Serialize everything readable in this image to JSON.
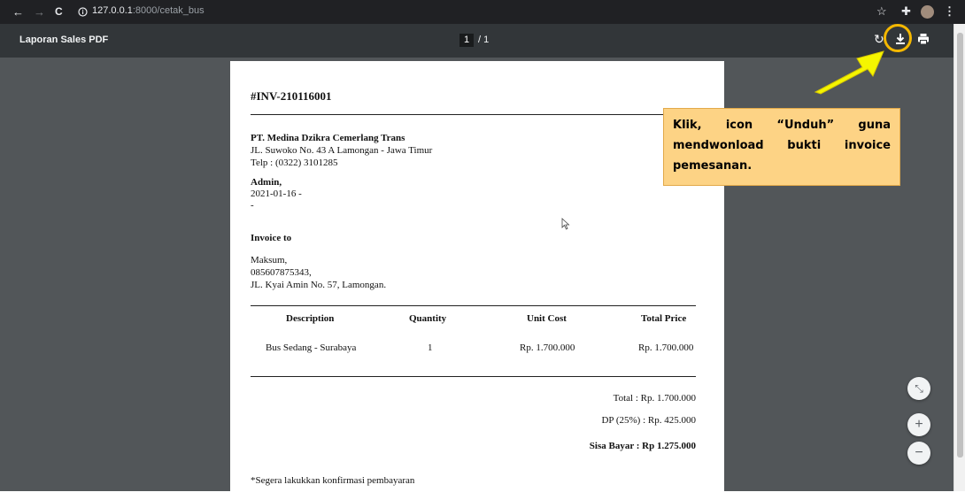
{
  "browser": {
    "nav": {
      "back": "←",
      "forward": "→",
      "reload": "C"
    },
    "info_icon": "info-circle-icon",
    "url_host": "127.0.0.1",
    "url_path": ":8000/cetak_bus",
    "right_icons": {
      "star": "☆",
      "extensions": "✚",
      "menu": "⋮"
    }
  },
  "pdf_toolbar": {
    "title": "Laporan Sales PDF",
    "current_page": "1",
    "page_separator": "/ 1",
    "rotate": "↻"
  },
  "invoice": {
    "number": "#INV-210116001",
    "company_name": "PT. Medina Dzikra Cemerlang Trans",
    "company_address": "JL. Suwoko No. 43 A Lamongan - Jawa Timur",
    "company_phone": "Telp : (0322) 3101285",
    "admin_label": "Admin,",
    "admin_date": "2021-01-16 -",
    "admin_extra": "-",
    "invoice_to_label": "Invoice to",
    "customer_name": "Maksum,",
    "customer_phone": "085607875343,",
    "customer_address": "JL. Kyai Amin No. 57, Lamongan.",
    "table": {
      "headers": [
        "Description",
        "Quantity",
        "Unit Cost",
        "Total Price"
      ],
      "rows": [
        [
          "Bus Sedang - Surabaya",
          "1",
          "Rp. 1.700.000",
          "Rp. 1.700.000"
        ]
      ]
    },
    "total": "Total : Rp. 1.700.000",
    "dp": "DP (25%) : Rp. 425.000",
    "sisa_bayar": "Sisa Bayar : Rp 1.275.000",
    "note": "*Segera lakukkan konfirmasi pembayaran"
  },
  "annotation": {
    "text": "Klik, icon “Unduh” guna mendwonload bukti invoice pemesanan.",
    "color": "#fdd385",
    "arrow_color": "#f5f500",
    "ring_color": "#f5b800"
  },
  "zoom_controls": {
    "fit": "⤡",
    "zoom_in": "+",
    "zoom_out": "−"
  }
}
